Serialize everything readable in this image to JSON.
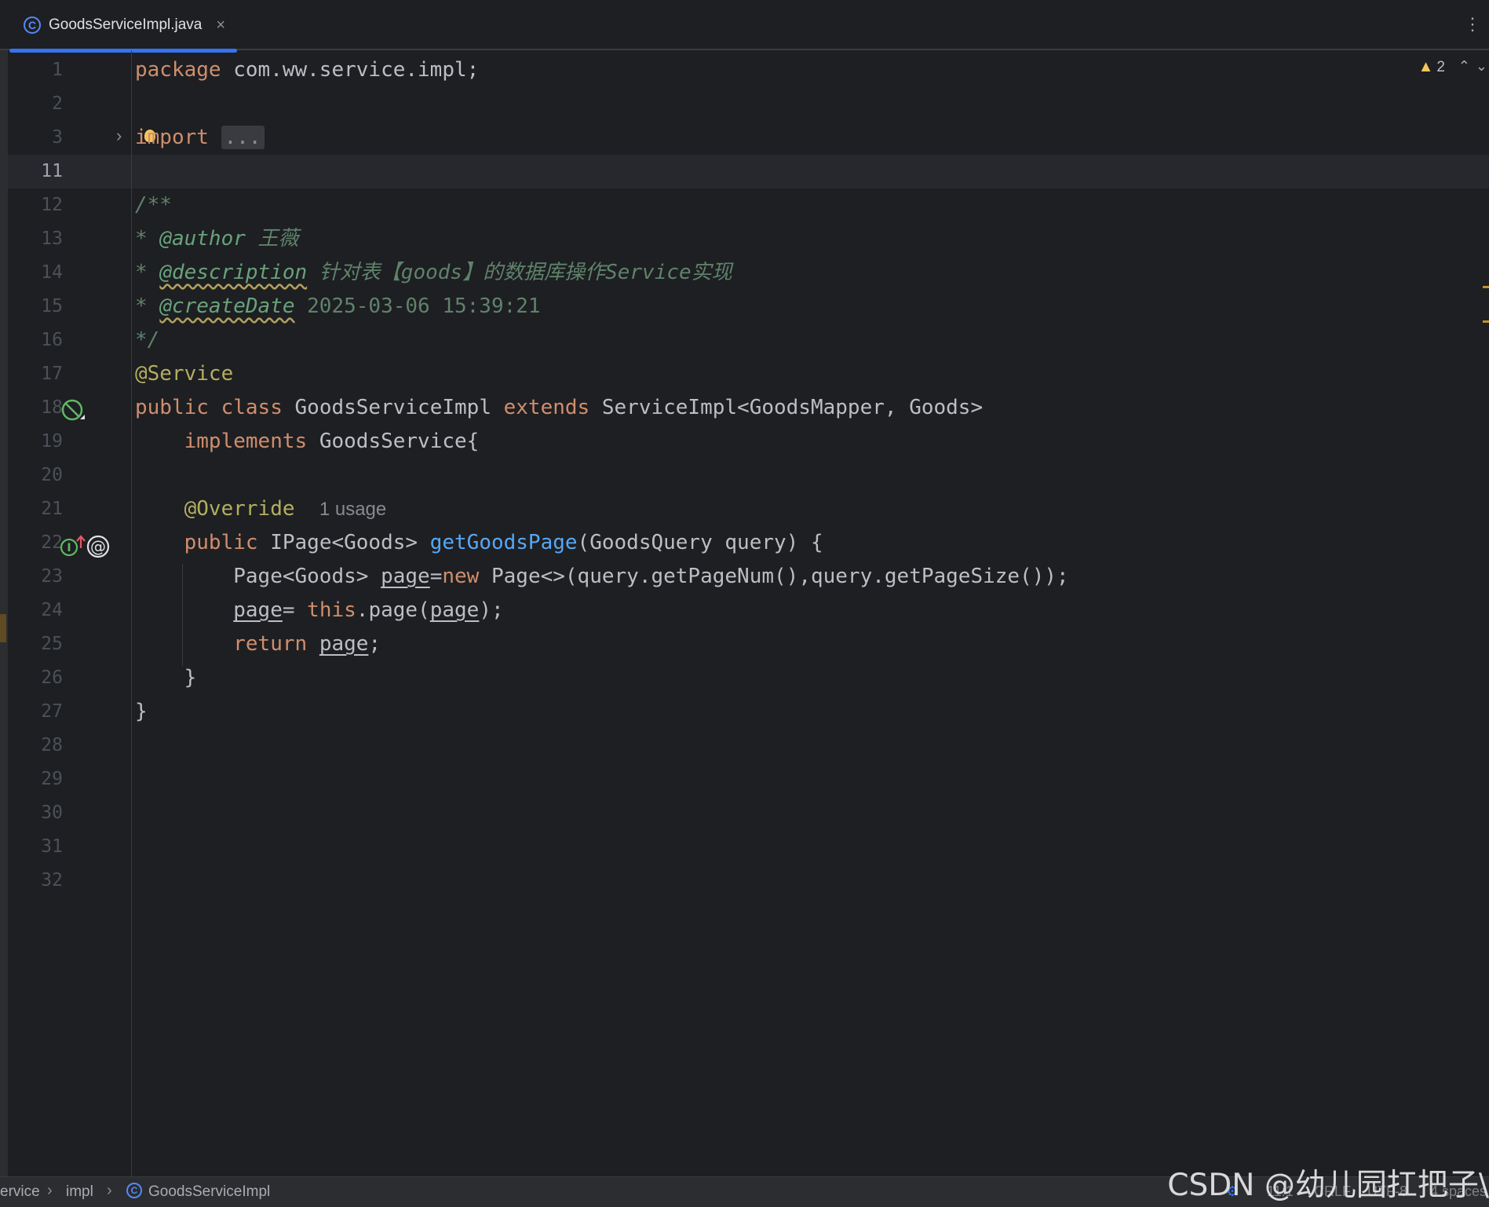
{
  "tab": {
    "filename": "GoodsServiceImpl.java",
    "icon": "class-icon",
    "close": "×"
  },
  "editor": {
    "warnings_count": "2",
    "line_numbers": [
      "1",
      "2",
      "3",
      "11",
      "12",
      "13",
      "14",
      "15",
      "16",
      "17",
      "18",
      "19",
      "20",
      "21",
      "22",
      "23",
      "24",
      "25",
      "26",
      "27",
      "28",
      "29",
      "30",
      "31",
      "32"
    ],
    "active_line": "11",
    "code": {
      "l1_kw": "package",
      "l1_rest": " com.ww.service.impl;",
      "l3_kw": "import",
      "l3_fold": "...",
      "l12": "/**",
      "l13_star": "* ",
      "l13_tag": "@author",
      "l13_text": " 王薇",
      "l14_star": "* ",
      "l14_tag": "@description",
      "l14_text": " 针对表【goods】的数据库操作Service实现",
      "l15_star": "* ",
      "l15_tag": "@createDate",
      "l15_text": " 2025-03-06 15:39:21",
      "l16": "*/",
      "l17": "@Service",
      "l18_kw1": "public",
      "l18_kw2": "class",
      "l18_name": " GoodsServiceImpl ",
      "l18_kw3": "extends",
      "l18_rest": " ServiceImpl<GoodsMapper, Goods>",
      "l19_kw": "implements",
      "l19_rest": " GoodsService{",
      "l21_ann": "@Override",
      "l21_hint": "1 usage",
      "l22_kw": "public",
      "l22_type": " IPage<Goods> ",
      "l22_fn": "getGoodsPage",
      "l22_rest": "(GoodsQuery query) {",
      "l23_type": "Page<Goods> ",
      "l23_var": "page",
      "l23_eq": "=",
      "l23_kw": "new",
      "l23_rest": " Page<>(query.getPageNum(),query.getPageSize());",
      "l24_var": "page",
      "l24_eq": "= ",
      "l24_kw": "this",
      "l24_call": ".page(",
      "l24_arg": "page",
      "l24_end": ");",
      "l25_kw": "return",
      "l25_sp": " ",
      "l25_var": "page",
      "l25_end": ";",
      "l26": "}",
      "l27": "}"
    }
  },
  "breadcrumb": [
    "ervice",
    "impl",
    "GoodsServiceImpl"
  ],
  "status": {
    "position": "11:1",
    "line_sep": "CRLF",
    "encoding": "UTF-8",
    "indent": "4 spaces"
  },
  "watermark": "CSDN @幼儿园扛把子\\"
}
